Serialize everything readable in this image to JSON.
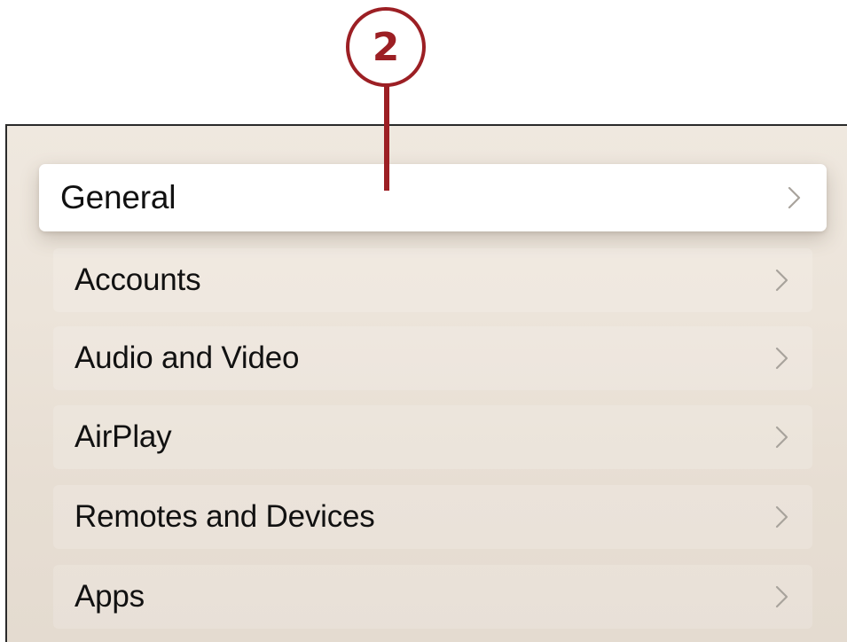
{
  "callout": {
    "number": "2",
    "color": "#9c1f24"
  },
  "settings_menu": {
    "items": [
      {
        "label": "General",
        "focused": true,
        "icon": "chevron-right-icon"
      },
      {
        "label": "Accounts",
        "focused": false,
        "icon": "chevron-right-icon"
      },
      {
        "label": "Audio and Video",
        "focused": false,
        "icon": "chevron-right-icon"
      },
      {
        "label": "AirPlay",
        "focused": false,
        "icon": "chevron-right-icon"
      },
      {
        "label": "Remotes and Devices",
        "focused": false,
        "icon": "chevron-right-icon"
      },
      {
        "label": "Apps",
        "focused": false,
        "icon": "chevron-right-icon"
      }
    ]
  },
  "colors": {
    "background": "#ece4da",
    "focused_row": "#ffffff",
    "text": "#111111",
    "chevron": "#a8a39c"
  }
}
